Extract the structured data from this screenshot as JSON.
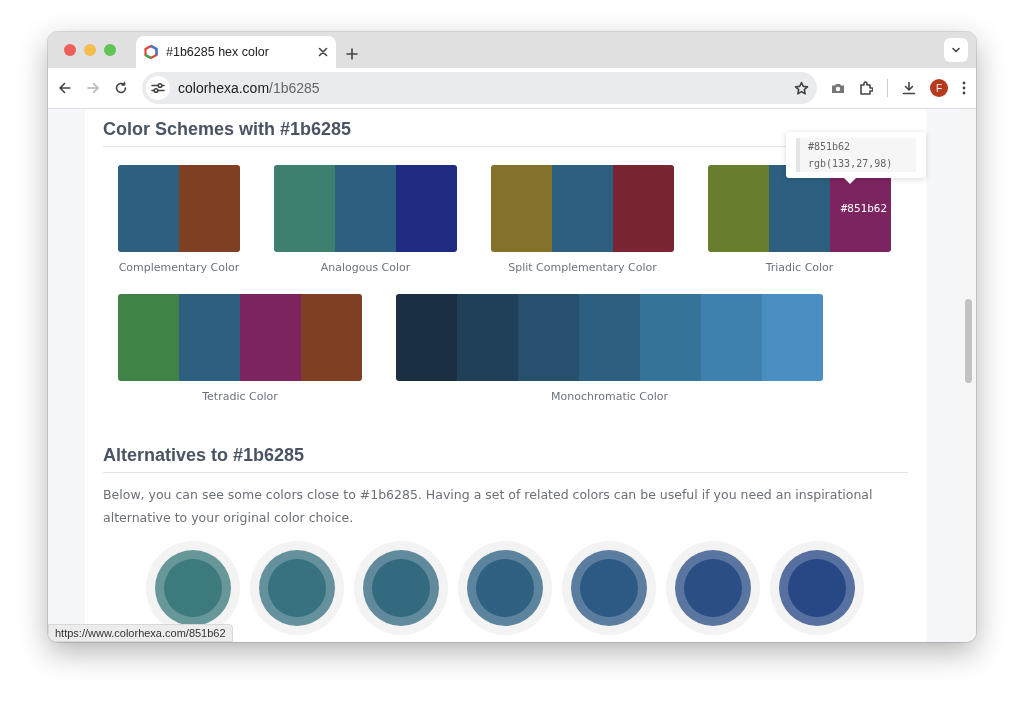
{
  "browser": {
    "tab": {
      "title": "#1b6285 hex color",
      "selected": true
    },
    "address": {
      "domain": "colorhexa.com",
      "path": "/1b6285"
    },
    "forward_disabled": true,
    "profile": "F"
  },
  "schemes": {
    "title": "Color Schemes with #1b6285",
    "items": [
      {
        "name": "Complementary Color",
        "cells": [
          {
            "color": "#2d5f80"
          },
          {
            "color": "#7e3f22"
          }
        ]
      },
      {
        "name": "Analogous Color",
        "cells": [
          {
            "color": "#3d8070"
          },
          {
            "color": "#2d5f80"
          },
          {
            "color": "#1f2b80"
          }
        ]
      },
      {
        "name": "Split Complementary Color",
        "cells": [
          {
            "color": "#84722a"
          },
          {
            "color": "#2d5f80"
          },
          {
            "color": "#7a2532"
          }
        ]
      },
      {
        "name": "Triadic Color",
        "cells": [
          {
            "color": "#667e2e"
          },
          {
            "color": "#2d5f80"
          },
          {
            "color": "#7b2460",
            "label": "#851b62",
            "tooltip": {
              "hex": "#851b62",
              "rgb": "rgb(133,27,98)"
            }
          }
        ]
      },
      {
        "name": "Tetradic Color",
        "cells": [
          {
            "color": "#3f8446"
          },
          {
            "color": "#2d5f80"
          },
          {
            "color": "#7b2460"
          },
          {
            "color": "#7e3f22"
          }
        ]
      },
      {
        "name": "Monochromatic Color",
        "cells": [
          {
            "color": "#1b2f42"
          },
          {
            "color": "#203f58"
          },
          {
            "color": "#26506e"
          },
          {
            "color": "#2d5f80"
          },
          {
            "color": "#367399"
          },
          {
            "color": "#3e80ae"
          },
          {
            "color": "#4a8fc2"
          }
        ]
      }
    ]
  },
  "alternatives": {
    "title": "Alternatives to #1b6285",
    "text": "Below, you can see some colors close to #1b6285. Having a set of related colors can be useful if you need an inspirational alternative to your original color choice.",
    "swatches": [
      {
        "color": "#3d7a7e"
      },
      {
        "color": "#387280"
      },
      {
        "color": "#346a80"
      },
      {
        "color": "#2e6182"
      },
      {
        "color": "#2d5a85"
      },
      {
        "color": "#2b4f85"
      },
      {
        "color": "#284885"
      }
    ]
  },
  "status_url": "https://www.colorhexa.com/851b62"
}
